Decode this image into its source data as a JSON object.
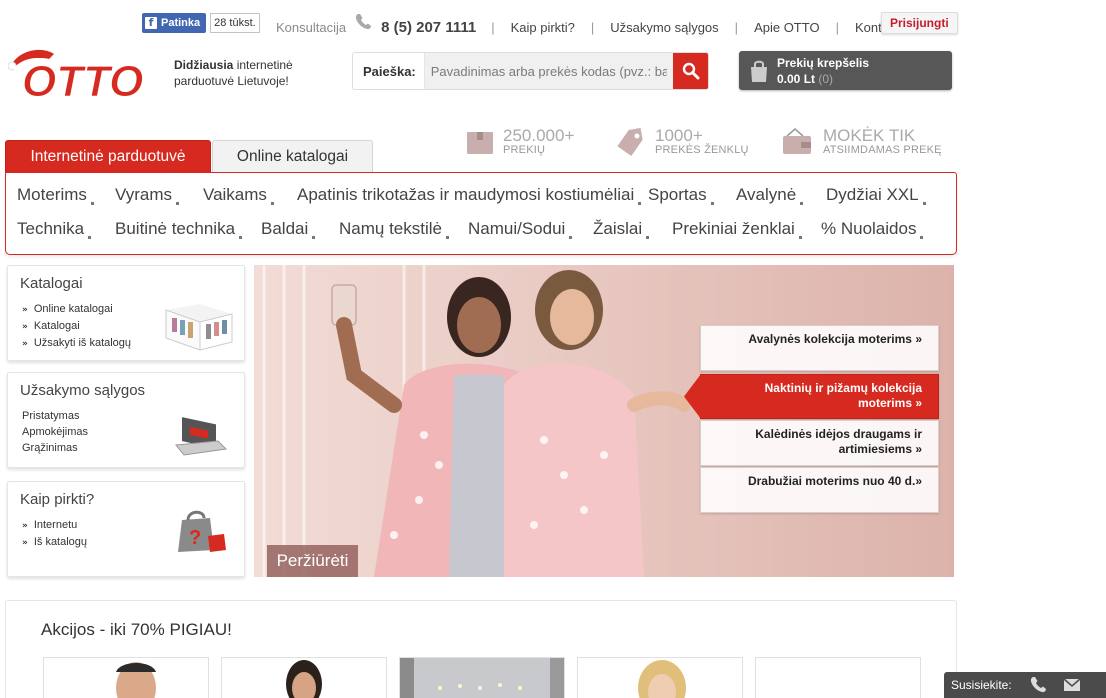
{
  "facebook": {
    "like_label": "Patinka",
    "count": "28 tūkst."
  },
  "topbar": {
    "consult_label": "Konsultacija",
    "phone": "8 (5) 207 1111",
    "links": [
      "Kaip pirkti?",
      "Užsakymo sąlygos",
      "Apie OTTO",
      "Kontaktai"
    ],
    "login": "Prisijungti"
  },
  "brand": {
    "logo_text": "OTTO",
    "tagline_bold": "Didžiausia",
    "tagline_rest_1": " internetinė",
    "tagline_rest_2": "parduotuvė Lietuvoje!"
  },
  "search": {
    "label": "Paieška:",
    "placeholder": "Pavadinimas arba prekės kodas (pvz.: batai)"
  },
  "cart": {
    "title": "Prekių krepšelis",
    "total": "0.00 Lt",
    "count": "(0)"
  },
  "tabs": [
    {
      "label": "Internetinė parduotuvė"
    },
    {
      "label": "Online katalogai"
    }
  ],
  "usps": [
    {
      "big": "250.000+",
      "small": "PREKIŲ"
    },
    {
      "big": "1000+",
      "small": "PREKĖS ŽENKLŲ"
    },
    {
      "big": "MOKĖK TIK",
      "small": "ATSIIMDAMAS PREKĘ"
    }
  ],
  "categories_row1": [
    "Moterims",
    "Vyrams",
    "Vaikams",
    "Apatinis trikotažas ir maudymosi kostiumėliai",
    "Sportas",
    "Avalynė",
    "Dydžiai XXL"
  ],
  "categories_row2": [
    "Technika",
    "Buitinė technika",
    "Baldai",
    "Namų tekstilė",
    "Namui/Sodui",
    "Žaislai",
    "Prekiniai ženklai",
    "% Nuolaidos"
  ],
  "sidebar": [
    {
      "title": "Katalogai",
      "items": [
        "Online katalogai",
        "Katalogai",
        "Užsakyti iš katalogų"
      ]
    },
    {
      "title": "Užsakymo sąlygos",
      "items": [
        "Pristatymas",
        "Apmokėjimas",
        "Grąžinimas"
      ]
    },
    {
      "title": "Kaip pirkti?",
      "items": [
        "Internetu",
        "Iš katalogų"
      ]
    }
  ],
  "hero": {
    "links": [
      "Avalynės kolekcija moterims »",
      "Naktinių ir pižamų kolekcija moterims »",
      "Kalėdinės idėjos draugams ir artimiesiems »",
      "Drabužiai moterims nuo 40 d.»"
    ],
    "view_label": "Peržiūrėti"
  },
  "promo": {
    "title": "Akcijos - iki 70% PIGIAU!"
  },
  "contact_bar": {
    "label": "Susisiekite:"
  },
  "colors": {
    "brand_red": "#d62a20",
    "cart_dark": "#575757",
    "facebook": "#4267b2"
  }
}
